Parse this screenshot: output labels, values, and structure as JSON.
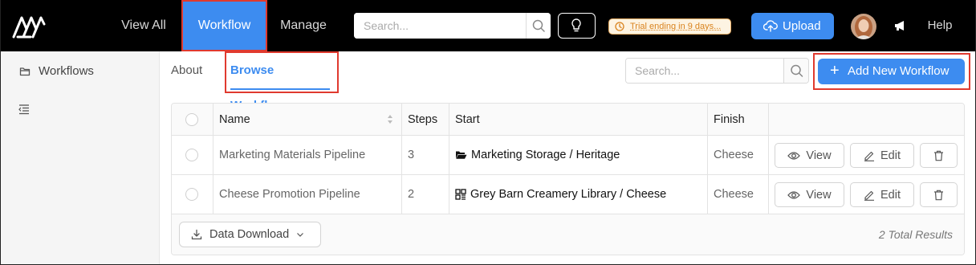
{
  "topbar": {
    "nav": {
      "view_all": "View All",
      "workflow": "Workflow",
      "manage": "Manage"
    },
    "search_placeholder": "Search...",
    "trial_text": "Trial ending in 9 days...",
    "upload_label": "Upload",
    "help_label": "Help"
  },
  "sidebar": {
    "items": [
      {
        "label": "Workflows",
        "icon": "folder-icon"
      }
    ],
    "collapse_icon": "collapse-menu-icon"
  },
  "tabs": [
    {
      "label": "About"
    },
    {
      "label": "Browse Workflows",
      "active": true
    }
  ],
  "main_search_placeholder": "Search...",
  "add_button_label": "Add New Workflow",
  "table": {
    "columns": [
      "Name",
      "Steps",
      "Start",
      "Finish"
    ],
    "rows": [
      {
        "name": "Marketing Materials Pipeline",
        "steps": "3",
        "start_icon": "folder-icon",
        "start": "Marketing Storage / Heritage",
        "finish": "Cheese"
      },
      {
        "name": "Cheese Promotion Pipeline",
        "steps": "2",
        "start_icon": "library-icon",
        "start": "Grey Barn Creamery Library / Cheese",
        "finish": "Cheese"
      }
    ],
    "actions": {
      "view": "View",
      "edit": "Edit"
    }
  },
  "footer": {
    "download_label": "Data Download",
    "total": "2 Total Results"
  },
  "colors": {
    "accent": "#3d8cf0",
    "highlight": "#e03a2f",
    "trial_bg": "#fdf3e2",
    "trial_text": "#d9831e"
  }
}
